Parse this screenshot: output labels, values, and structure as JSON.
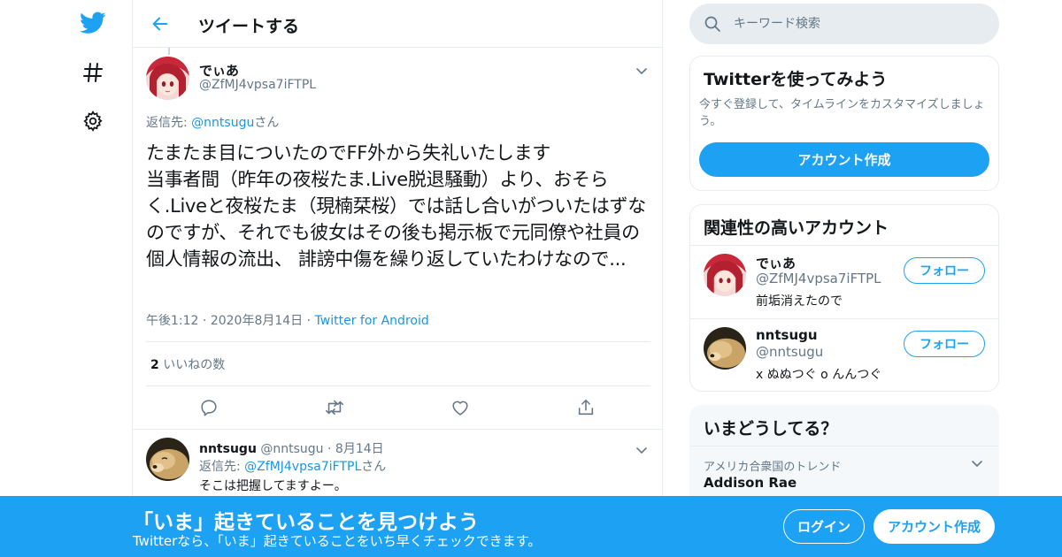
{
  "nav": {
    "logo_icon": "twitter-bird-icon",
    "explore_icon": "hashtag-icon",
    "settings_icon": "gear-icon"
  },
  "header": {
    "title": "ツイートする",
    "back_icon": "arrow-left-icon"
  },
  "tweet": {
    "name": "でぃあ",
    "handle": "@ZfMJ4vpsa7iFTPL",
    "reply_prefix": "返信先: ",
    "reply_to": "@nntsugu",
    "reply_suffix": "さん",
    "body": "たまたま目についたのでFF外から失礼いたします\n当事者間（昨年の夜桜たま.Live脱退騒動）より、おそらく.Liveと夜桜たま（現楠栞桜）では話し合いがついたはずなのですが、それでも彼女はその後も掲示板で元同僚や社員の個人情報の流出、 誹謗中傷を繰り返していたわけなので...",
    "time": "午後1:12",
    "date": "2020年8月14日",
    "source": "Twitter for Android",
    "likes_count": "2",
    "likes_label": "いいねの数"
  },
  "reply": {
    "name": "nntsugu",
    "handle": "@nntsugu",
    "date": "8月14日",
    "reply_prefix": "返信先: ",
    "reply_to": "@ZfMJ4vpsa7iFTPL",
    "reply_suffix": "さん",
    "text": "そこは把握してますよー。"
  },
  "search": {
    "placeholder": "キーワード検索"
  },
  "signup_card": {
    "title": "Twitterを使ってみよう",
    "text": "今すぐ登録して、タイムラインをカスタマイズしましょう。",
    "button": "アカウント作成"
  },
  "related": {
    "title": "関連性の高いアカウント",
    "follow_label": "フォロー",
    "accounts": [
      {
        "name": "でぃあ",
        "handle": "@ZfMJ4vpsa7iFTPL",
        "bio": "前垢消えたので"
      },
      {
        "name": "nntsugu",
        "handle": "@nntsugu",
        "bio": "x ぬぬつぐ o んんつぐ"
      }
    ]
  },
  "trends": {
    "title": "いまどうしてる？",
    "items": [
      {
        "label": "アメリカ合衆国のトレンド",
        "name": "Addison Rae"
      }
    ]
  },
  "banner": {
    "title": "「いま」起きていることを見つけよう",
    "subtitle": "Twitterなら、「いま」起きていることをいち早くチェックできます。",
    "login": "ログイン",
    "signup": "アカウント作成"
  },
  "colors": {
    "accent": "#1da1f2",
    "link": "#1b95e0",
    "muted": "#657786",
    "border": "#e6ecf0"
  }
}
